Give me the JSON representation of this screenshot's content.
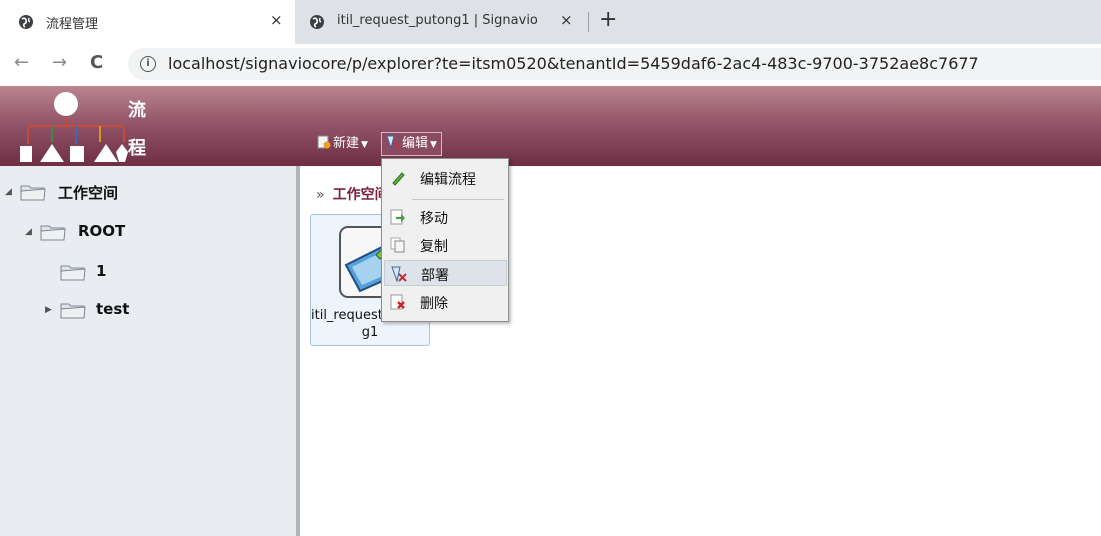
{
  "browser": {
    "tabs": [
      {
        "title": "流程管理",
        "close": "×"
      },
      {
        "title": "itil_request_putong1 | Signavio",
        "close": "×"
      }
    ],
    "new_tab": "+",
    "nav": {
      "back": "←",
      "forward": "→",
      "reload": "C"
    },
    "url": "localhost/signaviocore/p/explorer?te=itsm0520&tenantId=5459daf6-2ac4-483c-9700-3752ae8c7677"
  },
  "app": {
    "logo_text": [
      "流",
      "程"
    ],
    "toolbar": {
      "new_label": "新建",
      "edit_label": "编辑"
    },
    "edit_menu": {
      "items": [
        {
          "label": "编辑流程",
          "icon": "pencil-icon"
        },
        {
          "label": "移动",
          "icon": "move-icon"
        },
        {
          "label": "复制",
          "icon": "copy-icon"
        },
        {
          "label": "部署",
          "icon": "deploy-icon"
        },
        {
          "label": "删除",
          "icon": "delete-icon"
        }
      ],
      "hovered": "部署"
    },
    "tree": {
      "root": "工作空间",
      "items": [
        {
          "label": "ROOT"
        },
        {
          "label": "1"
        },
        {
          "label": "test"
        }
      ]
    },
    "breadcrumb": {
      "sep": "»",
      "item": "工作空间"
    },
    "files": [
      {
        "name_line1": "itil_request_putong1",
        "name_line2": "g1",
        "icon": "process-model-icon"
      }
    ]
  },
  "colors": {
    "header_top": "#b9868f",
    "header_bottom": "#6e2e44",
    "breadcrumb": "#7a1f3c",
    "sidebar_bg": "#e9edf1"
  }
}
